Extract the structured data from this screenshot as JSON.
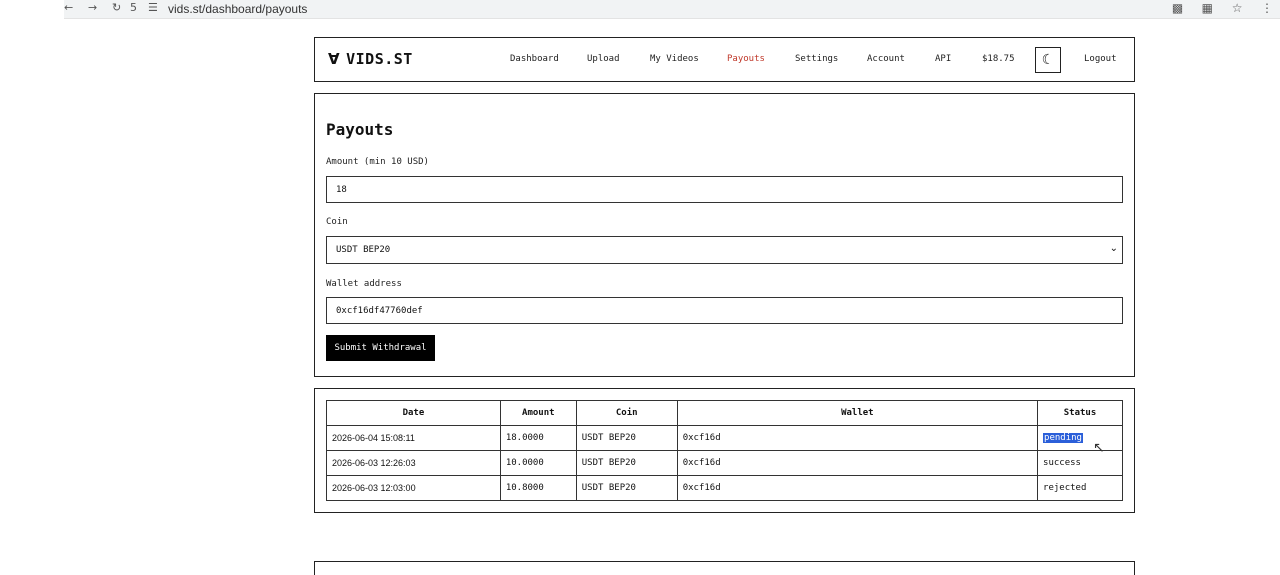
{
  "browser": {
    "url": "vids.st/dashboard/payouts",
    "tab_count": "5"
  },
  "header": {
    "logo_text": "VIDS.ST",
    "logo_mark": "Ɐ",
    "nav": [
      {
        "label": "Dashboard"
      },
      {
        "label": "Upload"
      },
      {
        "label": "My Videos"
      },
      {
        "label": "Payouts"
      },
      {
        "label": "Settings"
      },
      {
        "label": "Account"
      },
      {
        "label": "API"
      }
    ],
    "balance": "$18.75",
    "logout_label": "Logout",
    "accent_color": "#c0392b"
  },
  "form": {
    "title": "Payouts",
    "amount_label": "Amount (min 10 USD)",
    "amount_value": "18",
    "coin_label": "Coin",
    "coin_value": "USDT BEP20",
    "wallet_label": "Wallet address",
    "wallet_value": "0xcf16df47760def",
    "submit_label": "Submit Withdrawal"
  },
  "table": {
    "headers": [
      "Date",
      "Amount",
      "Coin",
      "Wallet",
      "Status"
    ],
    "rows": [
      {
        "date": "2026-06-04  15:08:11",
        "amount": "18.0000",
        "coin": "USDT BEP20",
        "wallet": "0xcf16d",
        "status": "pending"
      },
      {
        "date": "2026-06-03  12:26:03",
        "amount": "10.0000",
        "coin": "USDT BEP20",
        "wallet": "0xcf16d",
        "status": "success"
      },
      {
        "date": "2026-06-03  12:03:00",
        "amount": "10.8000",
        "coin": "USDT BEP20",
        "wallet": "0xcf16d",
        "status": "rejected"
      }
    ]
  },
  "icons": {
    "moon": "☾",
    "chevron": "⌄",
    "cursor": "↖"
  }
}
